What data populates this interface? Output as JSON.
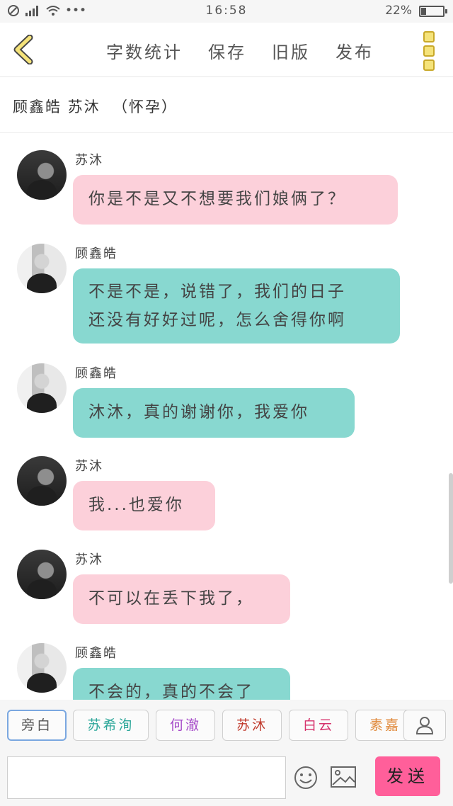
{
  "status_bar": {
    "time": "16:58",
    "battery": "22%",
    "battery_level": 0.22
  },
  "toolbar": {
    "word_count": "字数统计",
    "save": "保存",
    "old_version": "旧版",
    "publish": "发布"
  },
  "title": "顾鑫皓 苏沐  （怀孕）",
  "messages": [
    {
      "sender": "苏沐",
      "side": "pink",
      "text": "你是不是又不想要我们娘俩了？"
    },
    {
      "sender": "顾鑫皓",
      "side": "teal",
      "lines": [
        "不是不是，说错了，我们的日子",
        "还没有好好过呢，怎么舍得你啊"
      ]
    },
    {
      "sender": "顾鑫皓",
      "side": "teal",
      "text": "沐沐，真的谢谢你，我爱你"
    },
    {
      "sender": "苏沐",
      "side": "pink",
      "text": "我...也爱你"
    },
    {
      "sender": "苏沐",
      "side": "pink",
      "text": "不可以在丢下我了，"
    },
    {
      "sender": "顾鑫皓",
      "side": "teal",
      "text": "不会的，真的不会了"
    }
  ],
  "characters": [
    {
      "label": "旁白",
      "color": "#555555",
      "selected": true
    },
    {
      "label": "苏希洵",
      "color": "#2ea79a"
    },
    {
      "label": "何澈",
      "color": "#a64bc9"
    },
    {
      "label": "苏沐",
      "color": "#c0392b"
    },
    {
      "label": "白云",
      "color": "#d6336c"
    },
    {
      "label": "素嘉",
      "color": "#e08a3c"
    }
  ],
  "input": {
    "value": "",
    "send_label": "发送"
  },
  "icons": {
    "back": "chevron-left-icon",
    "more": "more-vertical-icon",
    "user": "user-icon",
    "emoji": "emoji-icon",
    "image": "image-icon"
  }
}
